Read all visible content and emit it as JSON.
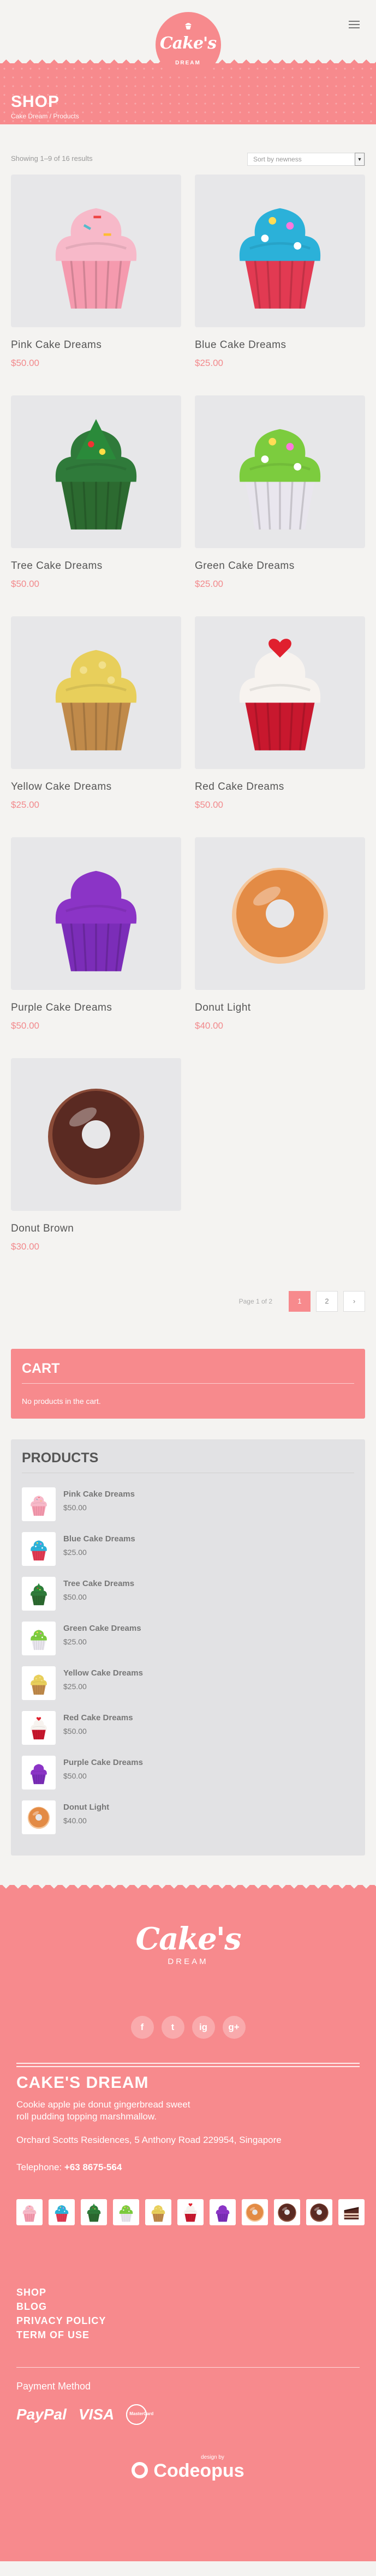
{
  "header": {
    "logo_text": "Cake's",
    "logo_sub": "DREAM",
    "menu_icon": "hamburger-icon"
  },
  "hero": {
    "title": "SHOP",
    "crumb_home": "Cake Dream",
    "crumb_sep": "/",
    "crumb_current": "Products"
  },
  "shop": {
    "result_count": "Showing 1–9 of 16 results",
    "sort_selected": "Sort by newness",
    "products": [
      {
        "name": "Pink Cake Dreams",
        "price": "$50.00",
        "kind": "cupcake",
        "frost": "#f7b9c9",
        "wrap": "#f59aae",
        "top": "sprinkle"
      },
      {
        "name": "Blue Cake Dreams",
        "price": "$25.00",
        "kind": "cupcake",
        "frost": "#2bb1d9",
        "wrap": "#e23a52",
        "top": "dots"
      },
      {
        "name": "Tree Cake Dreams",
        "price": "$50.00",
        "kind": "cupcake",
        "frost": "#2f7a3a",
        "wrap": "#2c6a30",
        "top": "tree"
      },
      {
        "name": "Green Cake Dreams",
        "price": "$25.00",
        "kind": "cupcake",
        "frost": "#7ccc3e",
        "wrap": "#e9e6ee",
        "top": "dots"
      },
      {
        "name": "Yellow Cake Dreams",
        "price": "$25.00",
        "kind": "cupcake",
        "frost": "#e8cf5b",
        "wrap": "#c08a4a",
        "top": "crumb"
      },
      {
        "name": "Red Cake Dreams",
        "price": "$50.00",
        "kind": "cupcake",
        "frost": "#f7f3ef",
        "wrap": "#c8182e",
        "top": "heart"
      },
      {
        "name": "Purple Cake Dreams",
        "price": "$50.00",
        "kind": "cupcake",
        "frost": "#8b34c6",
        "wrap": "#7b2db8",
        "top": "plain"
      },
      {
        "name": "Donut Light",
        "price": "$40.00",
        "kind": "donut",
        "frost": "#e38b45",
        "wrap": "#f5c69a",
        "top": "plain"
      },
      {
        "name": "Donut Brown",
        "price": "$30.00",
        "kind": "donut",
        "frost": "#5a2a22",
        "wrap": "#8a4b38",
        "top": "plain"
      }
    ],
    "pager": {
      "label": "Page 1 of 2",
      "page1": "1",
      "page2": "2",
      "next": "›"
    }
  },
  "cart": {
    "title": "CART",
    "empty_text": "No products in the cart."
  },
  "products_widget": {
    "title": "PRODUCTS",
    "items": [
      {
        "name": "Pink Cake Dreams",
        "price": "$50.00"
      },
      {
        "name": "Blue Cake Dreams",
        "price": "$25.00"
      },
      {
        "name": "Tree Cake Dreams",
        "price": "$50.00"
      },
      {
        "name": "Green Cake Dreams",
        "price": "$25.00"
      },
      {
        "name": "Yellow Cake Dreams",
        "price": "$25.00"
      },
      {
        "name": "Red Cake Dreams",
        "price": "$50.00"
      },
      {
        "name": "Purple Cake Dreams",
        "price": "$50.00"
      },
      {
        "name": "Donut Light",
        "price": "$40.00"
      }
    ]
  },
  "footer": {
    "logo_text": "Cake's",
    "logo_sub": "DREAM",
    "social": [
      "f",
      "t",
      "ig",
      "g+"
    ],
    "title": "CAKE'S DREAM",
    "description": "Cookie apple pie donut gingerbread sweet roll pudding topping marshmallow.",
    "address": "Orchard Scotts Residences, 5 Anthony Road 229954, Singapore",
    "tel_label": "Telephone:",
    "tel_value": "+63 8675-564",
    "links": [
      "SHOP",
      "BLOG",
      "PRIVACY POLICY",
      "TERM OF USE"
    ],
    "payment_title": "Payment Method",
    "pay_paypal": "PayPal",
    "pay_visa": "VISA",
    "pay_mc": "MasterCard",
    "designed_by": "design by",
    "designer": "Codeopus"
  },
  "colors": {
    "accent": "#f78a8d",
    "bg": "#f4f3f1",
    "panel": "#e2e2e4",
    "price": "#f2898c"
  }
}
